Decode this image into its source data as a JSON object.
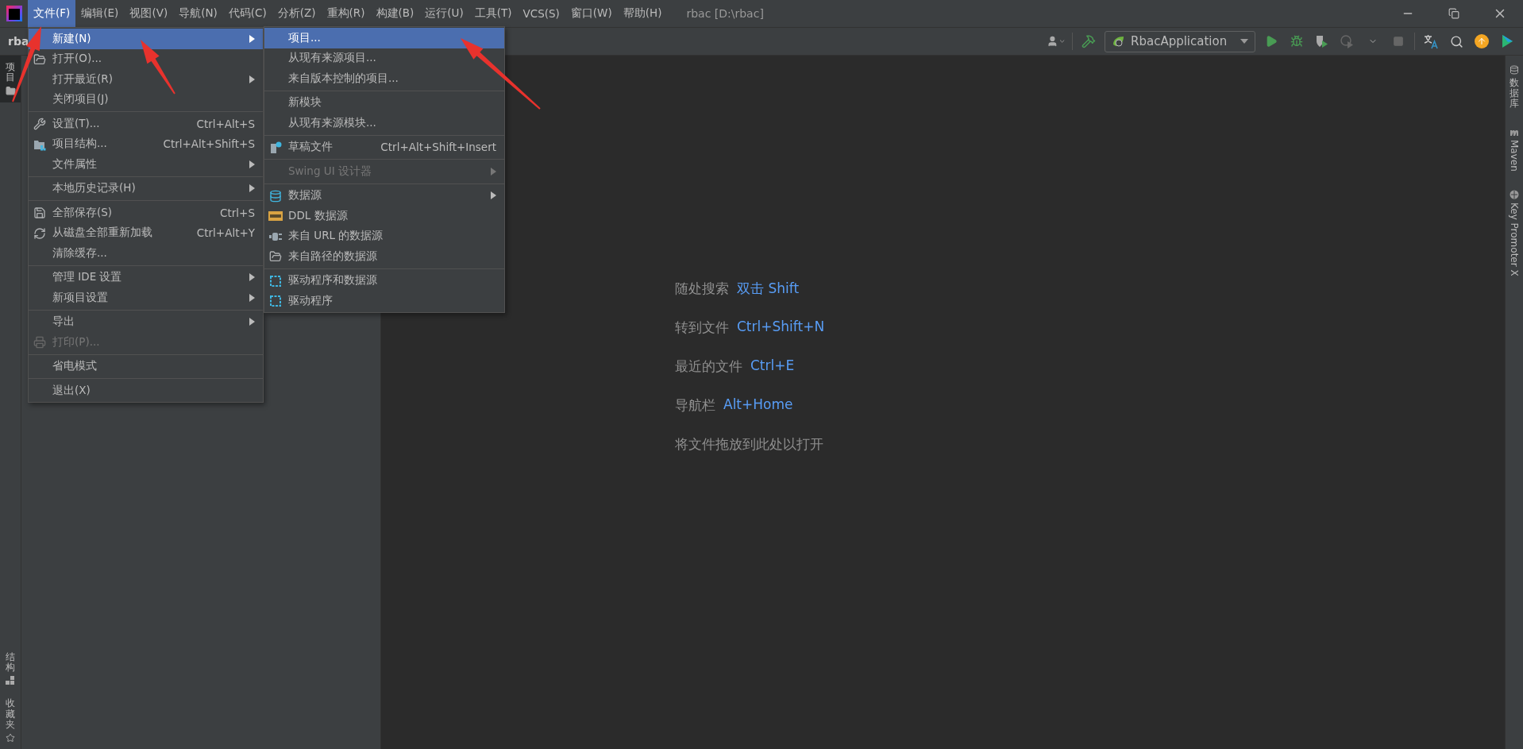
{
  "window": {
    "title": "rbac [D:\\rbac]"
  },
  "menu_bar": [
    {
      "label": "文件(F)",
      "selected": true
    },
    {
      "label": "编辑(E)",
      "selected": false
    },
    {
      "label": "视图(V)",
      "selected": false
    },
    {
      "label": "导航(N)",
      "selected": false
    },
    {
      "label": "代码(C)",
      "selected": false
    },
    {
      "label": "分析(Z)",
      "selected": false
    },
    {
      "label": "重构(R)",
      "selected": false
    },
    {
      "label": "构建(B)",
      "selected": false
    },
    {
      "label": "运行(U)",
      "selected": false
    },
    {
      "label": "工具(T)",
      "selected": false
    },
    {
      "label": "VCS(S)",
      "selected": false
    },
    {
      "label": "窗口(W)",
      "selected": false
    },
    {
      "label": "帮助(H)",
      "selected": false
    }
  ],
  "breadcrumb": "rba",
  "toolbar": {
    "run_config": "RbacApplication"
  },
  "file_menu": [
    {
      "kind": "item",
      "label": "新建(N)",
      "submenu": true,
      "selected": true,
      "disabled": false
    },
    {
      "kind": "item",
      "label": "打开(O)...",
      "submenu": false,
      "selected": false,
      "disabled": false
    },
    {
      "kind": "item",
      "label": "打开最近(R)",
      "submenu": true,
      "selected": false,
      "disabled": false
    },
    {
      "kind": "item",
      "label": "关闭项目(J)",
      "submenu": false,
      "selected": false,
      "disabled": false
    },
    {
      "kind": "separator"
    },
    {
      "kind": "item",
      "label": "设置(T)...",
      "shortcut": "Ctrl+Alt+S",
      "submenu": false,
      "selected": false,
      "disabled": false
    },
    {
      "kind": "item",
      "label": "项目结构...",
      "shortcut": "Ctrl+Alt+Shift+S",
      "submenu": false,
      "selected": false,
      "disabled": false
    },
    {
      "kind": "item",
      "label": "文件属性",
      "submenu": true,
      "selected": false,
      "disabled": false
    },
    {
      "kind": "separator"
    },
    {
      "kind": "item",
      "label": "本地历史记录(H)",
      "submenu": true,
      "selected": false,
      "disabled": false
    },
    {
      "kind": "separator"
    },
    {
      "kind": "item",
      "label": "全部保存(S)",
      "shortcut": "Ctrl+S",
      "submenu": false,
      "selected": false,
      "disabled": false
    },
    {
      "kind": "item",
      "label": "从磁盘全部重新加载",
      "shortcut": "Ctrl+Alt+Y",
      "submenu": false,
      "selected": false,
      "disabled": false
    },
    {
      "kind": "item",
      "label": "清除缓存...",
      "submenu": false,
      "selected": false,
      "disabled": false
    },
    {
      "kind": "separator"
    },
    {
      "kind": "item",
      "label": "管理 IDE 设置",
      "submenu": true,
      "selected": false,
      "disabled": false
    },
    {
      "kind": "item",
      "label": "新项目设置",
      "submenu": true,
      "selected": false,
      "disabled": false
    },
    {
      "kind": "separator"
    },
    {
      "kind": "item",
      "label": "导出",
      "submenu": true,
      "selected": false,
      "disabled": false
    },
    {
      "kind": "item",
      "label": "打印(P)...",
      "submenu": false,
      "selected": false,
      "disabled": true
    },
    {
      "kind": "separator"
    },
    {
      "kind": "item",
      "label": "省电模式",
      "submenu": false,
      "selected": false,
      "disabled": false
    },
    {
      "kind": "separator"
    },
    {
      "kind": "item",
      "label": "退出(X)",
      "submenu": false,
      "selected": false,
      "disabled": false
    }
  ],
  "new_submenu": [
    {
      "kind": "item",
      "label": "项目...",
      "submenu": false,
      "selected": true,
      "disabled": false
    },
    {
      "kind": "item",
      "label": "从现有来源项目...",
      "submenu": false,
      "selected": false,
      "disabled": false
    },
    {
      "kind": "item",
      "label": "来自版本控制的项目...",
      "submenu": false,
      "selected": false,
      "disabled": false
    },
    {
      "kind": "separator"
    },
    {
      "kind": "item",
      "label": "新模块",
      "submenu": false,
      "selected": false,
      "disabled": false
    },
    {
      "kind": "item",
      "label": "从现有来源模块...",
      "submenu": false,
      "selected": false,
      "disabled": false
    },
    {
      "kind": "separator"
    },
    {
      "kind": "item",
      "label": "草稿文件",
      "shortcut": "Ctrl+Alt+Shift+Insert",
      "submenu": false,
      "selected": false,
      "disabled": false
    },
    {
      "kind": "separator"
    },
    {
      "kind": "item",
      "label": "Swing UI 设计器",
      "submenu": true,
      "selected": false,
      "disabled": true
    },
    {
      "kind": "separator"
    },
    {
      "kind": "item",
      "label": "数据源",
      "submenu": true,
      "selected": false,
      "disabled": false
    },
    {
      "kind": "item",
      "label": "DDL 数据源",
      "submenu": false,
      "selected": false,
      "disabled": false
    },
    {
      "kind": "item",
      "label": "来自 URL 的数据源",
      "submenu": false,
      "selected": false,
      "disabled": false
    },
    {
      "kind": "item",
      "label": "来自路径的数据源",
      "submenu": false,
      "selected": false,
      "disabled": false
    },
    {
      "kind": "separator"
    },
    {
      "kind": "item",
      "label": "驱动程序和数据源",
      "submenu": false,
      "selected": false,
      "disabled": false
    },
    {
      "kind": "item",
      "label": "驱动程序",
      "submenu": false,
      "selected": false,
      "disabled": false
    }
  ],
  "welcome_hints": [
    {
      "label": "随处搜索",
      "shortcut": "双击 Shift"
    },
    {
      "label": "转到文件",
      "shortcut": "Ctrl+Shift+N"
    },
    {
      "label": "最近的文件",
      "shortcut": "Ctrl+E"
    },
    {
      "label": "导航栏",
      "shortcut": "Alt+Home"
    },
    {
      "label": "将文件拖放到此处以打开"
    }
  ],
  "left_tool_strip": [
    {
      "label": "项目",
      "selected": true
    },
    {
      "label": "结构",
      "selected": false
    },
    {
      "label": "收藏夹",
      "selected": false
    }
  ],
  "right_tool_strip": [
    {
      "label": "数据库",
      "kind": "stacked"
    },
    {
      "label": "Maven",
      "kind": "rotated"
    },
    {
      "label": "Key Promoter X",
      "kind": "rotated"
    }
  ]
}
